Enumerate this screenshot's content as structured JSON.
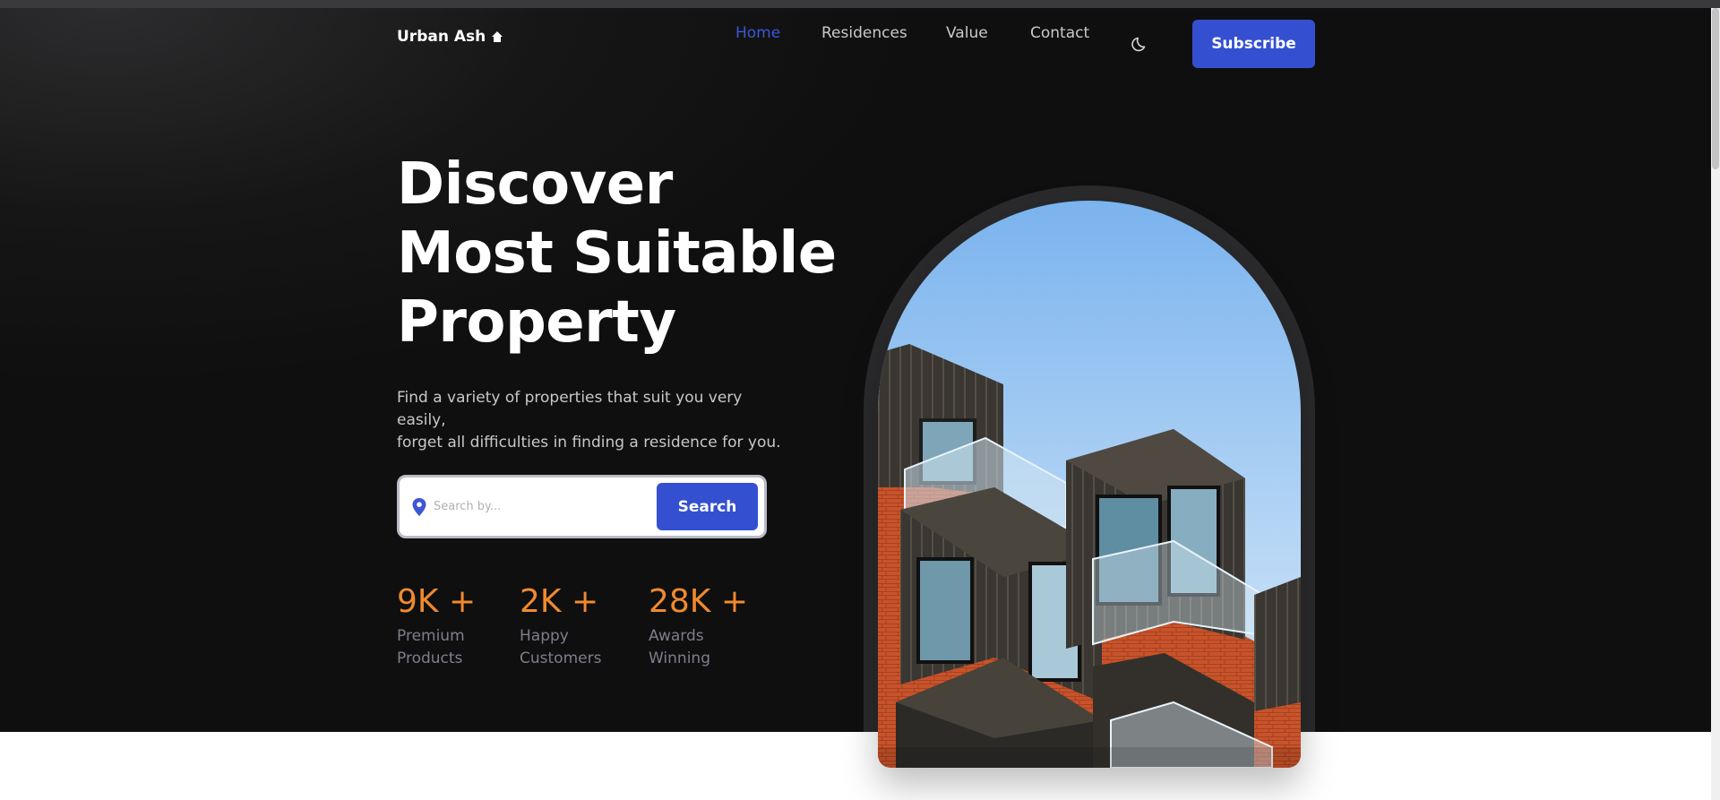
{
  "brand": {
    "name": "Urban Ash",
    "icon": "home-icon"
  },
  "nav": {
    "items": [
      {
        "label": "Home",
        "active": true
      },
      {
        "label": "Residences",
        "active": false
      },
      {
        "label": "Value",
        "active": false
      },
      {
        "label": "Contact",
        "active": false
      }
    ],
    "theme_toggle_icon": "moon-icon",
    "subscribe_label": "Subscribe"
  },
  "hero": {
    "title_lines": [
      "Discover",
      "Most Suitable",
      "Property"
    ],
    "subtitle_lines": [
      "Find a variety of properties that suit you very easily,",
      "forget all difficulties in finding a residence for you."
    ]
  },
  "search": {
    "icon": "location-pin-icon",
    "placeholder": "Search by...",
    "value": "",
    "button_label": "Search"
  },
  "stats": [
    {
      "value": "9K +",
      "label_lines": [
        "Premium",
        "Products"
      ]
    },
    {
      "value": "2K +",
      "label_lines": [
        "Happy",
        "Customers"
      ]
    },
    {
      "value": "28K +",
      "label_lines": [
        "Awards",
        "Winning"
      ]
    }
  ],
  "colors": {
    "accent": "#3450d1",
    "active_link": "#3d57d6",
    "stat_number": "#f08a2e",
    "hero_bg": "#111111"
  }
}
